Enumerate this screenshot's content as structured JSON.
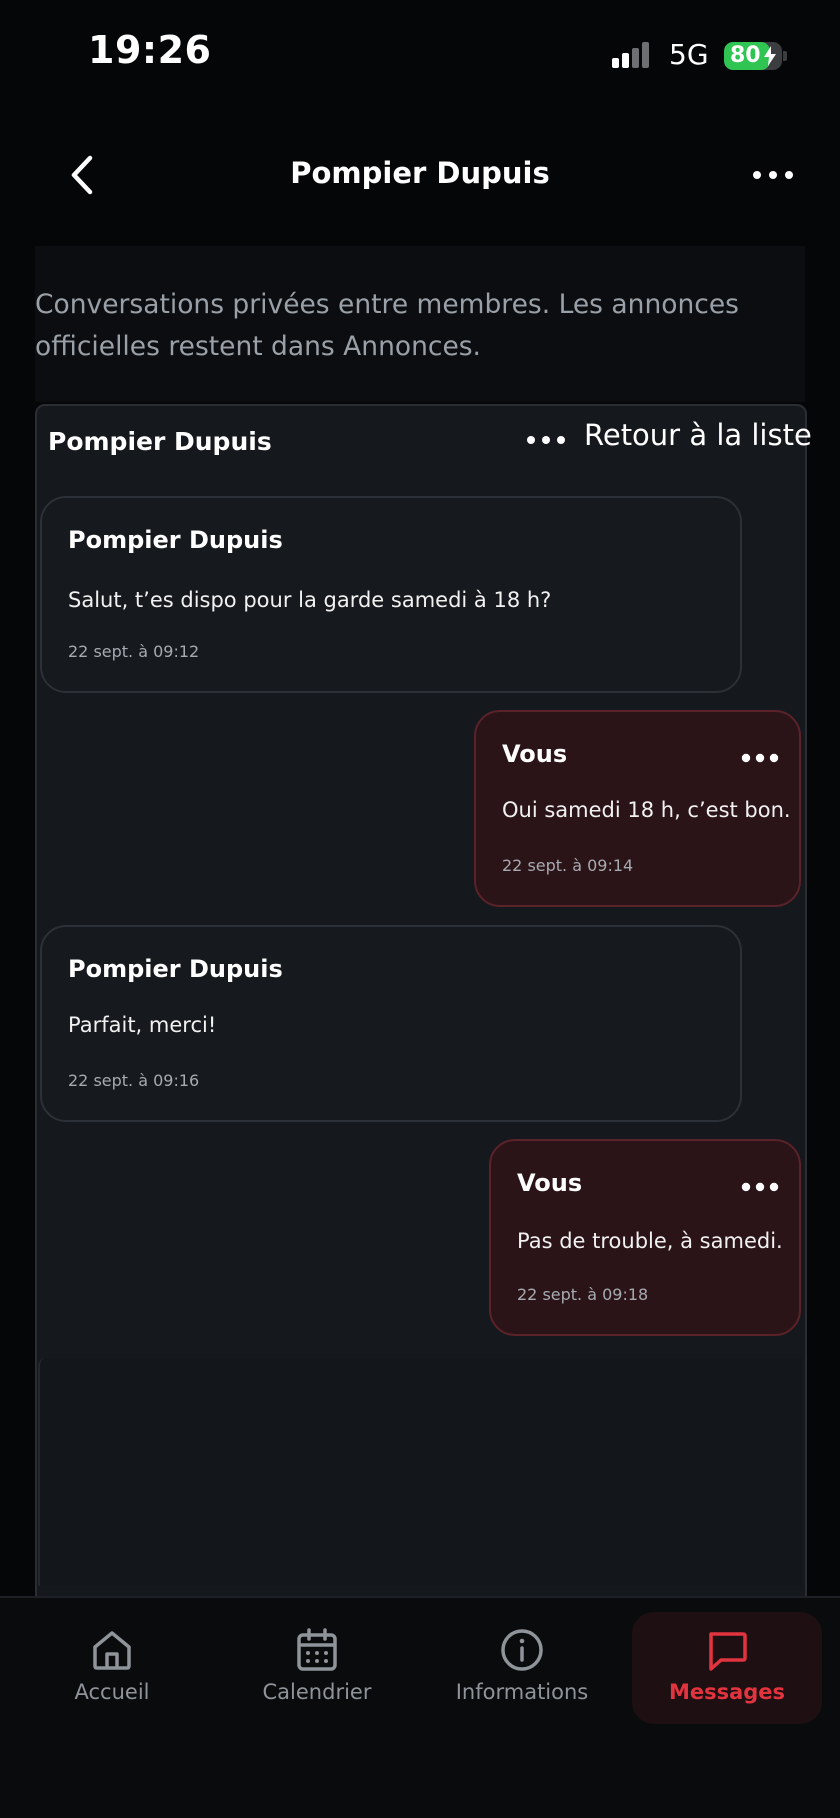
{
  "status_bar": {
    "time": "19:26",
    "network": "5G",
    "battery": "80",
    "battery_level": 0.8,
    "battery_color": "#30c552"
  },
  "header": {
    "title": "Pompier Dupuis",
    "back_icon": "chevron-left-icon",
    "more_icon": "more-horizontal-icon"
  },
  "info": {
    "text": "Conversations privées entre membres. Les annonces officielles restent dans Annonces."
  },
  "conversation": {
    "title": "Pompier Dupuis",
    "back_to_list": "Retour à la liste",
    "messages": [
      {
        "author": "Pompier Dupuis",
        "text": "Salut, t’es dispo pour la garde samedi à 18 h?",
        "time": "22 sept. à 09:12",
        "mine": false
      },
      {
        "author": "Vous",
        "text": "Oui samedi 18 h, c’est bon.",
        "time": "22 sept. à 09:14",
        "mine": true
      },
      {
        "author": "Pompier Dupuis",
        "text": "Parfait, merci!",
        "time": "22 sept. à 09:16",
        "mine": false
      },
      {
        "author": "Vous",
        "text": "Pas de trouble, à samedi.",
        "time": "22 sept. à 09:18",
        "mine": true
      }
    ]
  },
  "tabs": [
    {
      "label": "Accueil",
      "icon": "home-icon",
      "active": false
    },
    {
      "label": "Calendrier",
      "icon": "calendar-icon",
      "active": false
    },
    {
      "label": "Informations",
      "icon": "info-icon",
      "active": false
    },
    {
      "label": "Messages",
      "icon": "message-icon",
      "active": true
    }
  ],
  "colors": {
    "accent": "#e2343f",
    "outgoing_bubble": "#2b1418",
    "incoming_bubble": "#16191d"
  }
}
